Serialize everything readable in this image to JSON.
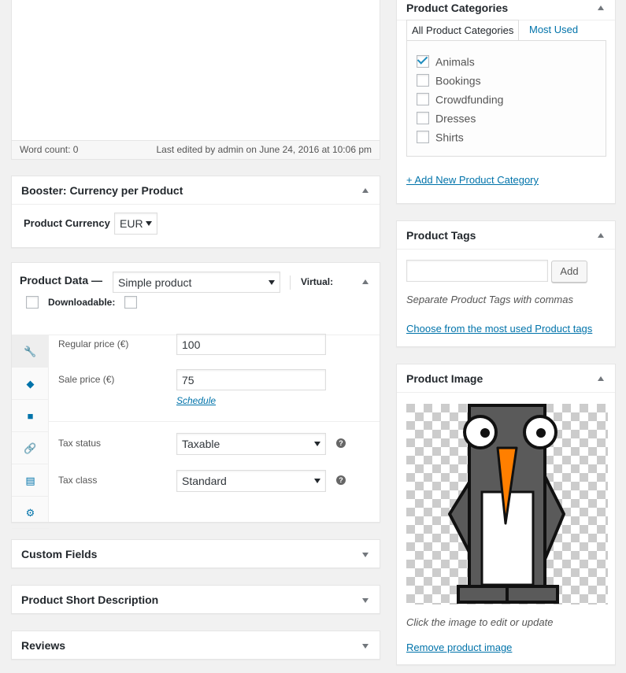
{
  "editor": {
    "word_count": "Word count: 0",
    "last_edited": "Last edited by admin on June 24, 2016 at 10:06 pm"
  },
  "currency_box": {
    "title": "Booster: Currency per Product",
    "label": "Product Currency",
    "value": "EUR"
  },
  "product_data": {
    "title": "Product Data —",
    "type_value": "Simple product",
    "virtual_label": "Virtual:",
    "downloadable_label": "Downloadable:",
    "tabs": [
      {
        "icon": "wrench-icon",
        "glyph": "🔧"
      },
      {
        "icon": "tag-icon",
        "glyph": "◆"
      },
      {
        "icon": "truck-icon",
        "glyph": "■"
      },
      {
        "icon": "link-icon",
        "glyph": "🔗"
      },
      {
        "icon": "list-icon",
        "glyph": "▤"
      },
      {
        "icon": "gear-icon",
        "glyph": "⚙"
      }
    ],
    "regular_price_label": "Regular price (€)",
    "regular_price_value": "100",
    "sale_price_label": "Sale price (€)",
    "sale_price_value": "75",
    "schedule_link": "Schedule",
    "tax_status_label": "Tax status",
    "tax_status_value": "Taxable",
    "tax_class_label": "Tax class",
    "tax_class_value": "Standard",
    "help_glyph": "?"
  },
  "collapsed_boxes": {
    "custom_fields": "Custom Fields",
    "short_description": "Product Short Description",
    "reviews": "Reviews"
  },
  "categories": {
    "title": "Product Categories",
    "tab_all": "All Product Categories",
    "tab_most_used": "Most Used",
    "items": [
      {
        "label": "Animals",
        "checked": true
      },
      {
        "label": "Bookings",
        "checked": false
      },
      {
        "label": "Crowdfunding",
        "checked": false
      },
      {
        "label": "Dresses",
        "checked": false
      },
      {
        "label": "Shirts",
        "checked": false
      }
    ],
    "add_link": "+ Add New Product Category"
  },
  "tags": {
    "title": "Product Tags",
    "input_value": "",
    "add_button": "Add",
    "hint": "Separate Product Tags with commas",
    "choose_link": "Choose from the most used Product tags"
  },
  "image_box": {
    "title": "Product Image",
    "hint": "Click the image to edit or update",
    "remove_link": "Remove product image"
  }
}
